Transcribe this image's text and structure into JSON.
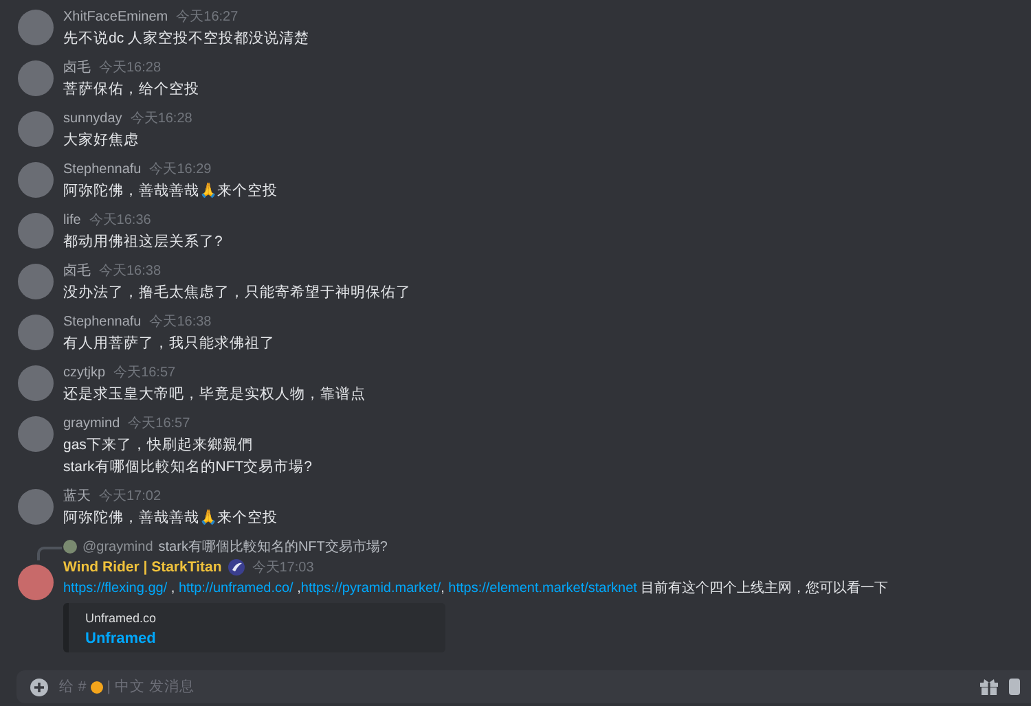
{
  "messages": [
    {
      "author": "XhitFaceEminem",
      "time": "今天16:27",
      "lines": [
        "先不说dc 人家空投不空投都没说清楚"
      ]
    },
    {
      "author": "卤毛",
      "time": "今天16:28",
      "lines": [
        "菩萨保佑，给个空投"
      ]
    },
    {
      "author": "sunnyday",
      "time": "今天16:28",
      "lines": [
        "大家好焦虑"
      ]
    },
    {
      "author": "Stephennafu",
      "time": "今天16:29",
      "lines": [
        "阿弥陀佛，善哉善哉🙏来个空投"
      ]
    },
    {
      "author": "life",
      "time": "今天16:36",
      "lines": [
        "都动用佛祖这层关系了?"
      ]
    },
    {
      "author": "卤毛",
      "time": "今天16:38",
      "lines": [
        "没办法了，撸毛太焦虑了，只能寄希望于神明保佑了"
      ]
    },
    {
      "author": "Stephennafu",
      "time": "今天16:38",
      "lines": [
        "有人用菩萨了，我只能求佛祖了"
      ]
    },
    {
      "author": "czytjkp",
      "time": "今天16:57",
      "lines": [
        "还是求玉皇大帝吧，毕竟是实权人物，靠谱点"
      ]
    },
    {
      "author": "graymind",
      "time": "今天16:57",
      "lines": [
        "gas下来了，快刷起来鄉親們",
        "stark有哪個比較知名的NFT交易市場?"
      ]
    },
    {
      "author": "蓝天",
      "time": "今天17:02",
      "lines": [
        "阿弥陀佛，善哉善哉🙏来个空投"
      ]
    }
  ],
  "reply_message": {
    "reply_to": {
      "author": "@graymind",
      "text": "stark有哪個比較知名的NFT交易市場?"
    },
    "author": "Wind Rider | StarkTitan",
    "time": "今天17:03",
    "parts": [
      {
        "kind": "link",
        "text": "https://flexing.gg/"
      },
      {
        "kind": "text",
        "text": " , "
      },
      {
        "kind": "link",
        "text": "http://unframed.co/"
      },
      {
        "kind": "text",
        "text": " ,"
      },
      {
        "kind": "link",
        "text": "https://pyramid.market/"
      },
      {
        "kind": "text",
        "text": ", "
      },
      {
        "kind": "link",
        "text": "https://element.market/starknet"
      },
      {
        "kind": "text",
        "text": " 目前有这个四个上线主网，您可以看一下"
      }
    ],
    "embed": {
      "site": "Unframed.co",
      "title": "Unframed"
    }
  },
  "composer": {
    "placeholder_prefix": "给 #",
    "placeholder_suffix": "| 中文 发消息"
  }
}
